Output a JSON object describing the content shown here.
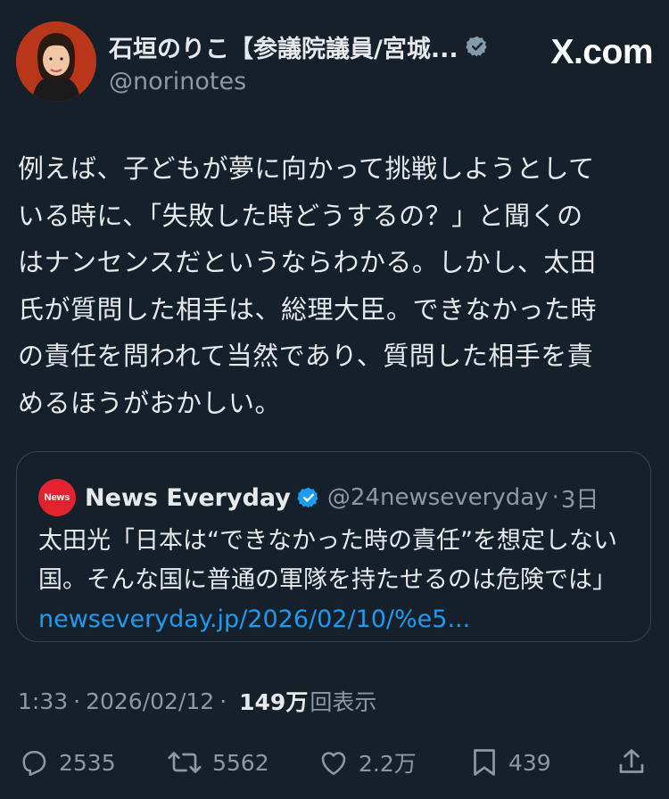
{
  "author": {
    "display_name": "石垣のりこ【参議院議員/宮城...",
    "handle": "@norinotes",
    "avatar_icon": "profile-photo-icon",
    "verified_icon": "verified-gray-badge-icon"
  },
  "watermark": {
    "text": "X.com"
  },
  "post": {
    "lines": [
      "例えば、子どもが夢に向かって挑戦しようとして",
      "いる時に、「失敗した時どうするの？」と聞くの",
      "はナンセンスだというならわかる。しかし、太田",
      "氏が質問した相手は、総理大臣。できなかった時",
      "の責任を問われて当然であり、質問した相手を責",
      "めるほうがおかしい。"
    ]
  },
  "quote": {
    "logo_text": "News",
    "name": "News Everyday",
    "verified_icon": "verified-blue-badge-icon",
    "handle": "@24newseveryday",
    "dot": "·",
    "time": "3日",
    "lines": [
      "太田光「日本は“できなかった時の責任”を想定しない",
      "国。そんな国に普通の軍隊を持たせるのは危険では」"
    ],
    "link": "newseveryday.jp/2026/02/10/%e5..."
  },
  "meta": {
    "time": "1:33",
    "sep": "·",
    "date": "2026/02/12",
    "views_count": "149万",
    "views_label": "回表示"
  },
  "actions": {
    "reply_count": "2535",
    "retweet_count": "5562",
    "like_count": "2.2万",
    "bookmark_count": "439"
  },
  "colors": {
    "background": "#15202b",
    "text": "#e7e9ea",
    "secondary": "#8b98a5",
    "link": "#1d9bf0",
    "border": "#38444d"
  }
}
